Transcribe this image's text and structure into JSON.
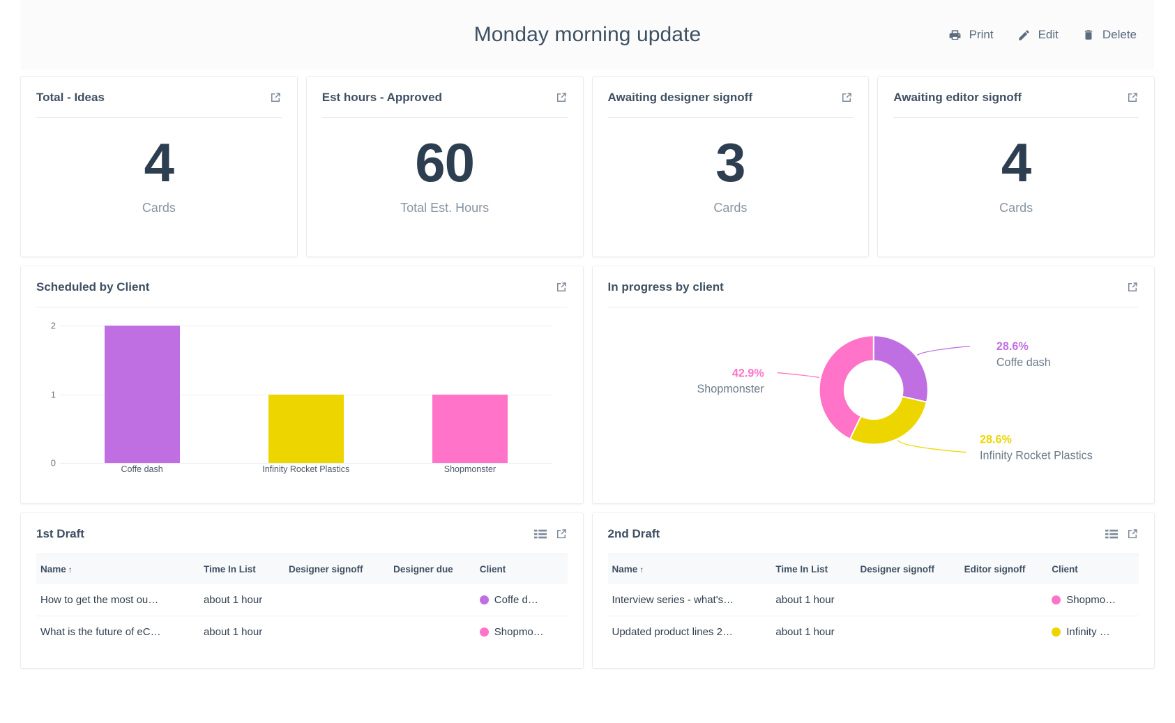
{
  "header": {
    "title": "Monday morning update",
    "actions": [
      {
        "label": "Print",
        "icon": "printer-icon"
      },
      {
        "label": "Edit",
        "icon": "pencil-icon"
      },
      {
        "label": "Delete",
        "icon": "trash-icon"
      }
    ]
  },
  "kpis": [
    {
      "title": "Total - Ideas",
      "value": "4",
      "label": "Cards"
    },
    {
      "title": "Est hours - Approved",
      "value": "60",
      "label": "Total Est. Hours"
    },
    {
      "title": "Awaiting designer signoff",
      "value": "3",
      "label": "Cards"
    },
    {
      "title": "Awaiting editor signoff",
      "value": "4",
      "label": "Cards"
    }
  ],
  "colors": {
    "purple": "#c06fe2",
    "yellow": "#edd600",
    "pink": "#ff74c8",
    "text_dark": "#2d3e50",
    "text_muted": "#8994a2"
  },
  "panels": {
    "bar_panel_title": "Scheduled by Client",
    "donut_panel_title": "In progress by client",
    "first_draft_title": "1st Draft",
    "second_draft_title": "2nd Draft"
  },
  "chart_data": [
    {
      "type": "bar",
      "title": "Scheduled by Client",
      "categories": [
        "Coffe dash",
        "Infinity Rocket Plastics",
        "Shopmonster"
      ],
      "values": [
        2,
        1,
        1
      ],
      "colors": [
        "#c06fe2",
        "#edd600",
        "#ff74c8"
      ],
      "yticks": [
        0,
        1,
        2
      ],
      "ylim": [
        0,
        2
      ],
      "xlabel": "",
      "ylabel": "",
      "grid": true,
      "legend": "none"
    },
    {
      "type": "pie",
      "title": "In progress by client",
      "donut": true,
      "labels": [
        "Coffe dash",
        "Infinity Rocket Plastics",
        "Shopmonster"
      ],
      "values": [
        28.6,
        28.6,
        42.9
      ],
      "percent_labels": [
        "28.6%",
        "28.6%",
        "42.9%"
      ],
      "colors": [
        "#c06fe2",
        "#edd600",
        "#ff74c8"
      ],
      "legend": "callout-labels"
    }
  ],
  "tables": [
    {
      "title": "1st Draft",
      "columns": [
        "Name",
        "Time In List",
        "Designer signoff",
        "Designer due",
        "Client"
      ],
      "sort_column": "Name",
      "sort_direction": "↑",
      "rows": [
        {
          "name": "How to get the most ou…",
          "time": "about 1 hour",
          "designer_signoff": "",
          "designer_due": "",
          "client": "Coffe d…",
          "client_color": "#c06fe2"
        },
        {
          "name": "What is the future of eC…",
          "time": "about 1 hour",
          "designer_signoff": "",
          "designer_due": "",
          "client": "Shopmo…",
          "client_color": "#ff74c8"
        }
      ]
    },
    {
      "title": "2nd Draft",
      "columns": [
        "Name",
        "Time In List",
        "Designer signoff",
        "Editor signoff",
        "Client"
      ],
      "sort_column": "Name",
      "sort_direction": "↑",
      "rows": [
        {
          "name": "Interview series - what's…",
          "time": "about 1 hour",
          "designer_signoff": "",
          "editor_signoff": "",
          "client": "Shopmo…",
          "client_color": "#ff74c8"
        },
        {
          "name": "Updated product lines 2…",
          "time": "about 1 hour",
          "designer_signoff": "",
          "editor_signoff": "",
          "client": "Infinity …",
          "client_color": "#edd600"
        }
      ]
    }
  ]
}
